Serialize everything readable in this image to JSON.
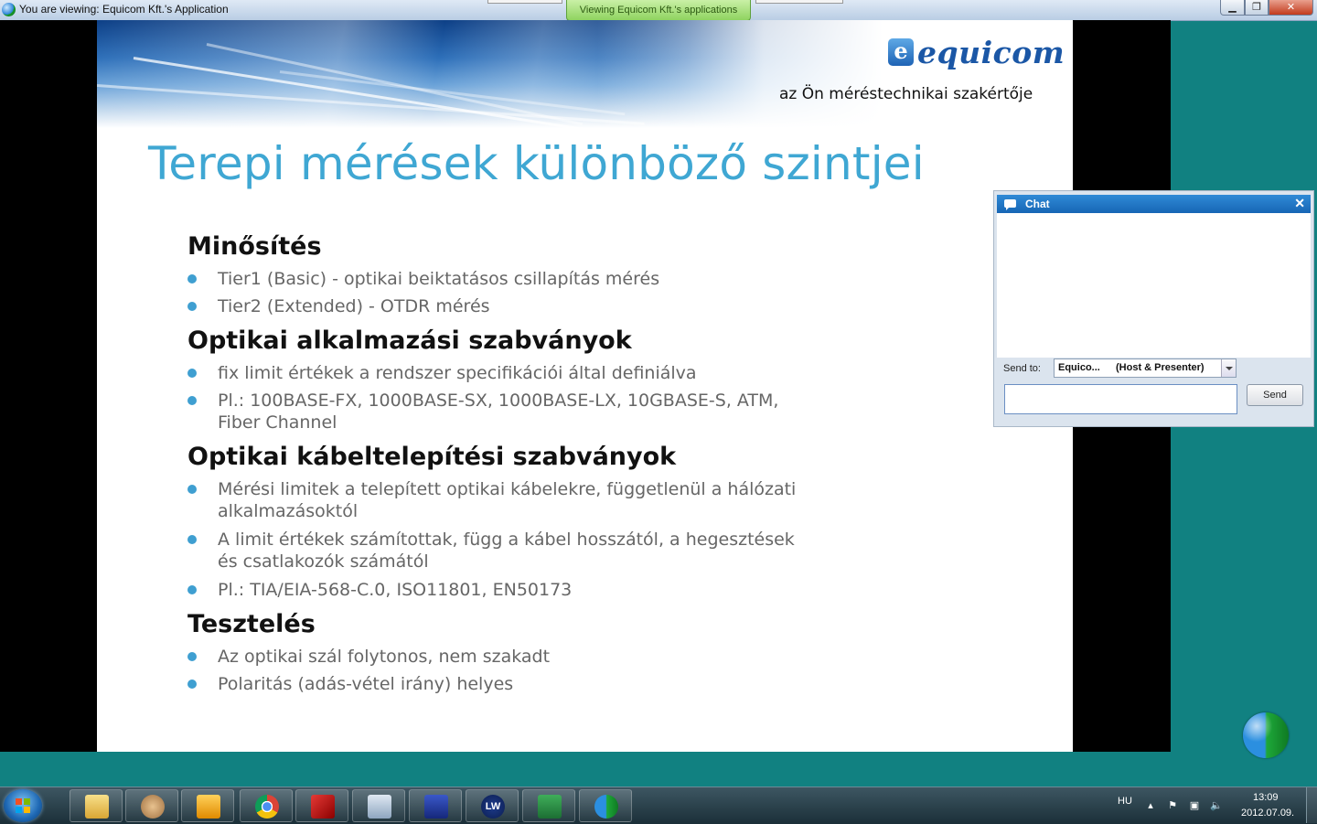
{
  "window": {
    "title": "You are viewing: Equicom Kft.'s Application",
    "viewing_tab": "Viewing Equicom Kft.'s applications",
    "minimize": "▁",
    "maximize": "❐",
    "close": "✕"
  },
  "slide": {
    "logo_text": "equicom",
    "logo_mark": "e",
    "tagline": "az Ön méréstechnikai szakértője",
    "title": "Terepi mérések különböző szintjei",
    "sections": [
      {
        "heading": "Minősítés",
        "bullets": [
          "Tier1 (Basic) - optikai beiktatásos csillapítás mérés",
          "Tier2 (Extended) - OTDR mérés"
        ]
      },
      {
        "heading": "Optikai alkalmazási szabványok",
        "bullets": [
          "fix limit értékek a rendszer specifikációi által definiálva",
          "Pl.: 100BASE-FX, 1000BASE-SX, 1000BASE-LX, 10GBASE-S, ATM, Fiber Channel"
        ]
      },
      {
        "heading": "Optikai kábeltelepítési szabványok",
        "bullets": [
          "Mérési limitek a telepített optikai kábelekre, függetlenül a hálózati alkalmazásoktól",
          "A limit értékek számítottak, függ a kábel hosszától, a hegesztések és csatlakozók számától",
          "Pl.: TIA/EIA-568-C.0, ISO11801, EN50173"
        ]
      },
      {
        "heading": "Tesztelés",
        "bullets": [
          "Az optikai szál folytonos, nem szakadt",
          "Polaritás (adás-vétel irány) helyes"
        ]
      }
    ]
  },
  "chat": {
    "title": "Chat",
    "close": "✕",
    "send_to_label": "Send to:",
    "recipient_name": "Equico...",
    "recipient_role": "(Host & Presenter)",
    "message": "",
    "send_label": "Send"
  },
  "taskbar": {
    "apps": [
      "folder-icon",
      "handshake-icon",
      "outlook-icon",
      "chrome-icon",
      "office-tool-icon",
      "calculator-icon",
      "floppy-save-icon",
      "livewire-icon",
      "excel-icon",
      "globe-icon"
    ],
    "lw_label": "LW",
    "language": "HU",
    "time": "13:09",
    "date": "2012.07.09."
  },
  "colors": {
    "title_blue": "#3fa7d3",
    "bullet_dot": "#3f9fd1",
    "desktop_teal": "#118181",
    "viewing_tab_green": "#8fd360"
  }
}
